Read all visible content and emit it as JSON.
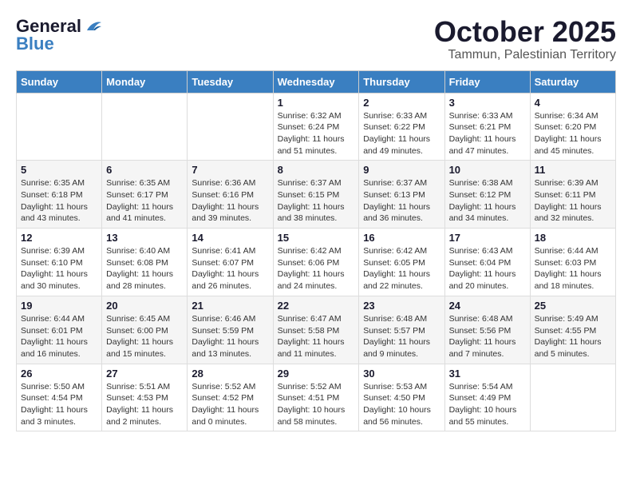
{
  "header": {
    "logo_general": "General",
    "logo_blue": "Blue",
    "month": "October 2025",
    "location": "Tammun, Palestinian Territory"
  },
  "days_of_week": [
    "Sunday",
    "Monday",
    "Tuesday",
    "Wednesday",
    "Thursday",
    "Friday",
    "Saturday"
  ],
  "weeks": [
    [
      {
        "day": "",
        "info": ""
      },
      {
        "day": "",
        "info": ""
      },
      {
        "day": "",
        "info": ""
      },
      {
        "day": "1",
        "info": "Sunrise: 6:32 AM\nSunset: 6:24 PM\nDaylight: 11 hours and 51 minutes."
      },
      {
        "day": "2",
        "info": "Sunrise: 6:33 AM\nSunset: 6:22 PM\nDaylight: 11 hours and 49 minutes."
      },
      {
        "day": "3",
        "info": "Sunrise: 6:33 AM\nSunset: 6:21 PM\nDaylight: 11 hours and 47 minutes."
      },
      {
        "day": "4",
        "info": "Sunrise: 6:34 AM\nSunset: 6:20 PM\nDaylight: 11 hours and 45 minutes."
      }
    ],
    [
      {
        "day": "5",
        "info": "Sunrise: 6:35 AM\nSunset: 6:18 PM\nDaylight: 11 hours and 43 minutes."
      },
      {
        "day": "6",
        "info": "Sunrise: 6:35 AM\nSunset: 6:17 PM\nDaylight: 11 hours and 41 minutes."
      },
      {
        "day": "7",
        "info": "Sunrise: 6:36 AM\nSunset: 6:16 PM\nDaylight: 11 hours and 39 minutes."
      },
      {
        "day": "8",
        "info": "Sunrise: 6:37 AM\nSunset: 6:15 PM\nDaylight: 11 hours and 38 minutes."
      },
      {
        "day": "9",
        "info": "Sunrise: 6:37 AM\nSunset: 6:13 PM\nDaylight: 11 hours and 36 minutes."
      },
      {
        "day": "10",
        "info": "Sunrise: 6:38 AM\nSunset: 6:12 PM\nDaylight: 11 hours and 34 minutes."
      },
      {
        "day": "11",
        "info": "Sunrise: 6:39 AM\nSunset: 6:11 PM\nDaylight: 11 hours and 32 minutes."
      }
    ],
    [
      {
        "day": "12",
        "info": "Sunrise: 6:39 AM\nSunset: 6:10 PM\nDaylight: 11 hours and 30 minutes."
      },
      {
        "day": "13",
        "info": "Sunrise: 6:40 AM\nSunset: 6:08 PM\nDaylight: 11 hours and 28 minutes."
      },
      {
        "day": "14",
        "info": "Sunrise: 6:41 AM\nSunset: 6:07 PM\nDaylight: 11 hours and 26 minutes."
      },
      {
        "day": "15",
        "info": "Sunrise: 6:42 AM\nSunset: 6:06 PM\nDaylight: 11 hours and 24 minutes."
      },
      {
        "day": "16",
        "info": "Sunrise: 6:42 AM\nSunset: 6:05 PM\nDaylight: 11 hours and 22 minutes."
      },
      {
        "day": "17",
        "info": "Sunrise: 6:43 AM\nSunset: 6:04 PM\nDaylight: 11 hours and 20 minutes."
      },
      {
        "day": "18",
        "info": "Sunrise: 6:44 AM\nSunset: 6:03 PM\nDaylight: 11 hours and 18 minutes."
      }
    ],
    [
      {
        "day": "19",
        "info": "Sunrise: 6:44 AM\nSunset: 6:01 PM\nDaylight: 11 hours and 16 minutes."
      },
      {
        "day": "20",
        "info": "Sunrise: 6:45 AM\nSunset: 6:00 PM\nDaylight: 11 hours and 15 minutes."
      },
      {
        "day": "21",
        "info": "Sunrise: 6:46 AM\nSunset: 5:59 PM\nDaylight: 11 hours and 13 minutes."
      },
      {
        "day": "22",
        "info": "Sunrise: 6:47 AM\nSunset: 5:58 PM\nDaylight: 11 hours and 11 minutes."
      },
      {
        "day": "23",
        "info": "Sunrise: 6:48 AM\nSunset: 5:57 PM\nDaylight: 11 hours and 9 minutes."
      },
      {
        "day": "24",
        "info": "Sunrise: 6:48 AM\nSunset: 5:56 PM\nDaylight: 11 hours and 7 minutes."
      },
      {
        "day": "25",
        "info": "Sunrise: 5:49 AM\nSunset: 4:55 PM\nDaylight: 11 hours and 5 minutes."
      }
    ],
    [
      {
        "day": "26",
        "info": "Sunrise: 5:50 AM\nSunset: 4:54 PM\nDaylight: 11 hours and 3 minutes."
      },
      {
        "day": "27",
        "info": "Sunrise: 5:51 AM\nSunset: 4:53 PM\nDaylight: 11 hours and 2 minutes."
      },
      {
        "day": "28",
        "info": "Sunrise: 5:52 AM\nSunset: 4:52 PM\nDaylight: 11 hours and 0 minutes."
      },
      {
        "day": "29",
        "info": "Sunrise: 5:52 AM\nSunset: 4:51 PM\nDaylight: 10 hours and 58 minutes."
      },
      {
        "day": "30",
        "info": "Sunrise: 5:53 AM\nSunset: 4:50 PM\nDaylight: 10 hours and 56 minutes."
      },
      {
        "day": "31",
        "info": "Sunrise: 5:54 AM\nSunset: 4:49 PM\nDaylight: 10 hours and 55 minutes."
      },
      {
        "day": "",
        "info": ""
      }
    ]
  ]
}
